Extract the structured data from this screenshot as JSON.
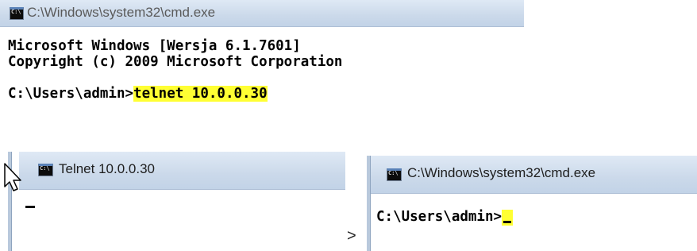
{
  "window1": {
    "title": "C:\\Windows\\system32\\cmd.exe",
    "lines": [
      "Microsoft Windows [Wersja 6.1.7601]",
      "Copyright (c) 2009 Microsoft Corporation"
    ],
    "prompt": "C:\\Users\\admin>",
    "command": "telnet 10.0.0.30"
  },
  "window2": {
    "title": "Telnet 10.0.0.30"
  },
  "separator": ">",
  "window3": {
    "title": "C:\\Windows\\system32\\cmd.exe",
    "prompt": "C:\\Users\\admin>"
  },
  "icons": {
    "window_icon": "cmd-icon",
    "pointer": "mouse-pointer-icon"
  },
  "colors": {
    "highlight": "#ffff33",
    "titlebar": "#cbd9ea"
  }
}
